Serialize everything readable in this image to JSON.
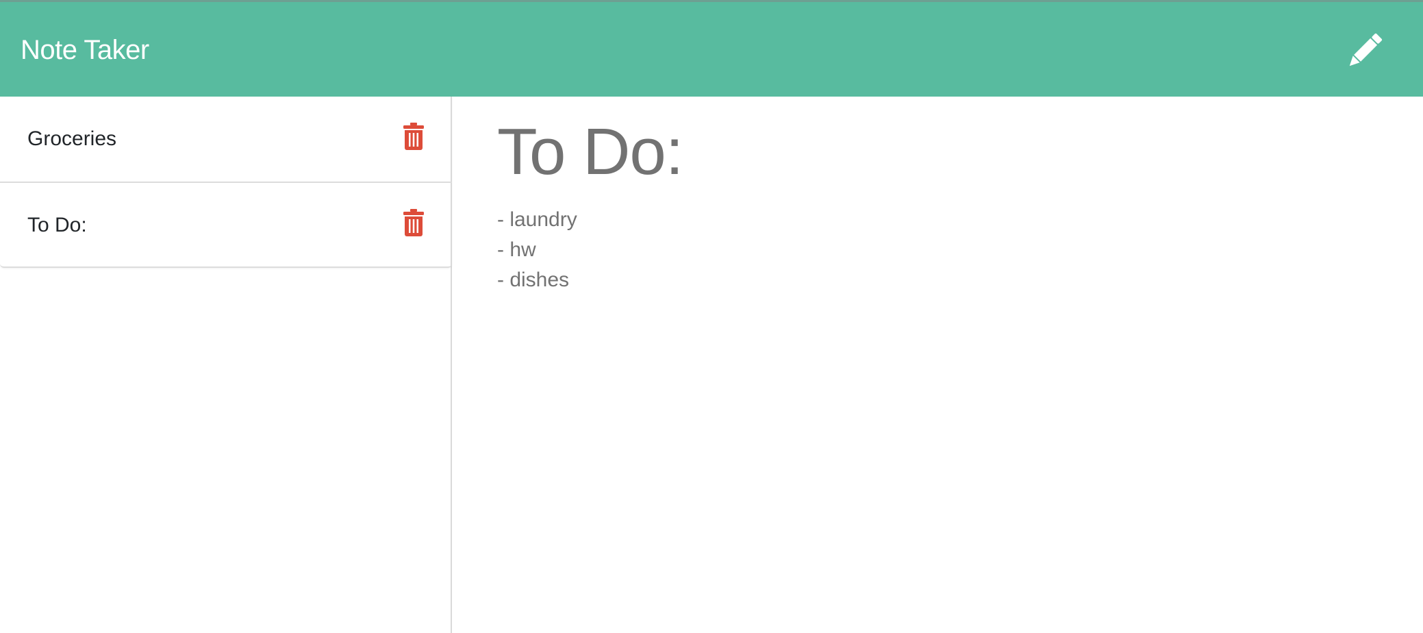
{
  "header": {
    "brand": "Note Taker",
    "new_note_icon": "pencil-icon"
  },
  "colors": {
    "navbar": "#58bb9f",
    "delete": "#dd4c39",
    "text_primary": "#212529",
    "text_muted": "#727272"
  },
  "notes": [
    {
      "title": "Groceries",
      "delete_icon": "trash-icon"
    },
    {
      "title": "To Do:",
      "delete_icon": "trash-icon"
    }
  ],
  "active_note": {
    "title": "To Do:",
    "lines": [
      "- laundry",
      "- hw",
      "- dishes"
    ]
  }
}
